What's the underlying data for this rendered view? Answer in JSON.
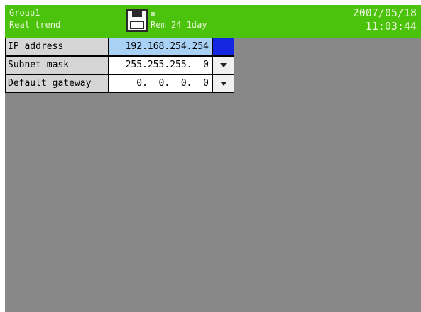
{
  "header": {
    "group": "Group1",
    "mode": "Real trend",
    "remaining": "Rem 24 1day",
    "date": "2007/05/18",
    "time": "11:03:44",
    "icons": {
      "media": "floppy-disk-icon",
      "access": "access-led-icon"
    }
  },
  "colors": {
    "header_bg": "#4bc30d",
    "panel_bg": "#888888",
    "selected_field": "#a9d1f6",
    "selected_dropdown": "#1326e0"
  },
  "settings": [
    {
      "label": "IP address",
      "value": "192.168.254.254",
      "selected": true
    },
    {
      "label": "Subnet mask",
      "value": "255.255.255.  0",
      "selected": false
    },
    {
      "label": "Default gateway",
      "value": "  0.  0.  0.  0",
      "selected": false
    }
  ]
}
